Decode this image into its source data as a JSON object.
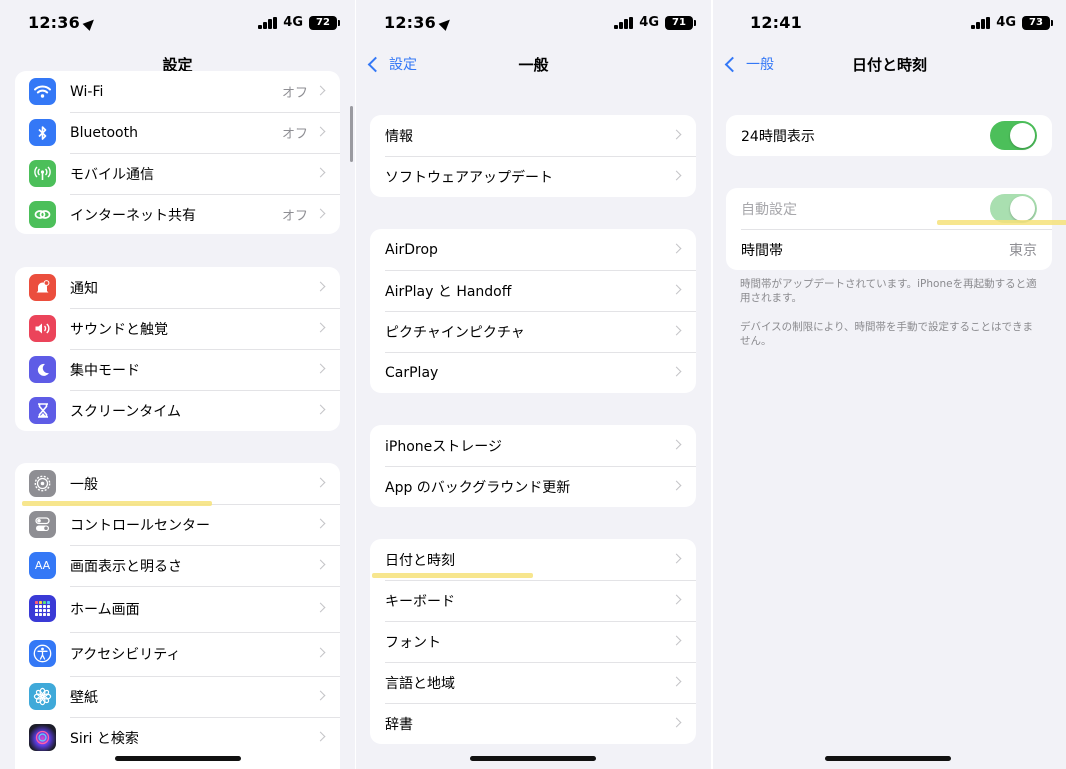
{
  "screen1": {
    "status": {
      "time": "12:36",
      "network": "4G",
      "battery": "72"
    },
    "nav_title": "設定",
    "group1": [
      {
        "label": "Wi-Fi",
        "value": "オフ",
        "icon": "wifi-icon",
        "color": "#3478f6"
      },
      {
        "label": "Bluetooth",
        "value": "オフ",
        "icon": "bluetooth-icon",
        "color": "#3478f6"
      },
      {
        "label": "モバイル通信",
        "value": "",
        "icon": "antenna-icon",
        "color": "#4cbf5a"
      },
      {
        "label": "インターネット共有",
        "value": "オフ",
        "icon": "link-icon",
        "color": "#4cbf5a"
      }
    ],
    "group2": [
      {
        "label": "通知",
        "icon": "bell-icon",
        "color": "#eb4e3d"
      },
      {
        "label": "サウンドと触覚",
        "icon": "speaker-icon",
        "color": "#eb445a"
      },
      {
        "label": "集中モード",
        "icon": "moon-icon",
        "color": "#5e5ce6"
      },
      {
        "label": "スクリーンタイム",
        "icon": "hourglass-icon",
        "color": "#5e5ce6"
      }
    ],
    "group3": [
      {
        "label": "一般",
        "icon": "gear-icon",
        "color": "#8e8e93"
      },
      {
        "label": "コントロールセンター",
        "icon": "switches-icon",
        "color": "#8e8e93"
      },
      {
        "label": "画面表示と明るさ",
        "icon": "text-size-icon",
        "color": "#3478f6"
      },
      {
        "label": "ホーム画面",
        "icon": "app-grid-icon",
        "color": "#3a3ad6"
      },
      {
        "label": "アクセシビリティ",
        "icon": "accessibility-icon",
        "color": "#3478f6"
      },
      {
        "label": "壁紙",
        "icon": "flower-icon",
        "color": "#3fa9d9"
      },
      {
        "label": "Siri と検索",
        "icon": "siri-icon",
        "color": "#222222"
      }
    ],
    "text_size_glyph": "AA"
  },
  "screen2": {
    "status": {
      "time": "12:36",
      "network": "4G",
      "battery": "71"
    },
    "back_label": "設定",
    "nav_title": "一般",
    "group1": [
      "情報",
      "ソフトウェアアップデート"
    ],
    "group2": [
      "AirDrop",
      "AirPlay と Handoff",
      "ピクチャインピクチャ",
      "CarPlay"
    ],
    "group3": [
      "iPhoneストレージ",
      "App のバックグラウンド更新"
    ],
    "group4": [
      "日付と時刻",
      "キーボード",
      "フォント",
      "言語と地域",
      "辞書"
    ]
  },
  "screen3": {
    "status": {
      "time": "12:41",
      "network": "4G",
      "battery": "73"
    },
    "back_label": "一般",
    "nav_title": "日付と時刻",
    "hour24_label": "24時間表示",
    "hour24_on": true,
    "auto_label": "自動設定",
    "auto_on": true,
    "timezone_label": "時間帯",
    "timezone_value": "東京",
    "note1": "時間帯がアップデートされています。iPhoneを再起動すると適用されます。",
    "note2": "デバイスの制限により、時間帯を手動で設定することはできません。"
  },
  "colors": {
    "accent": "#3478f6",
    "toggle_on": "#4cbf5a",
    "highlight": "#f6e27a"
  }
}
